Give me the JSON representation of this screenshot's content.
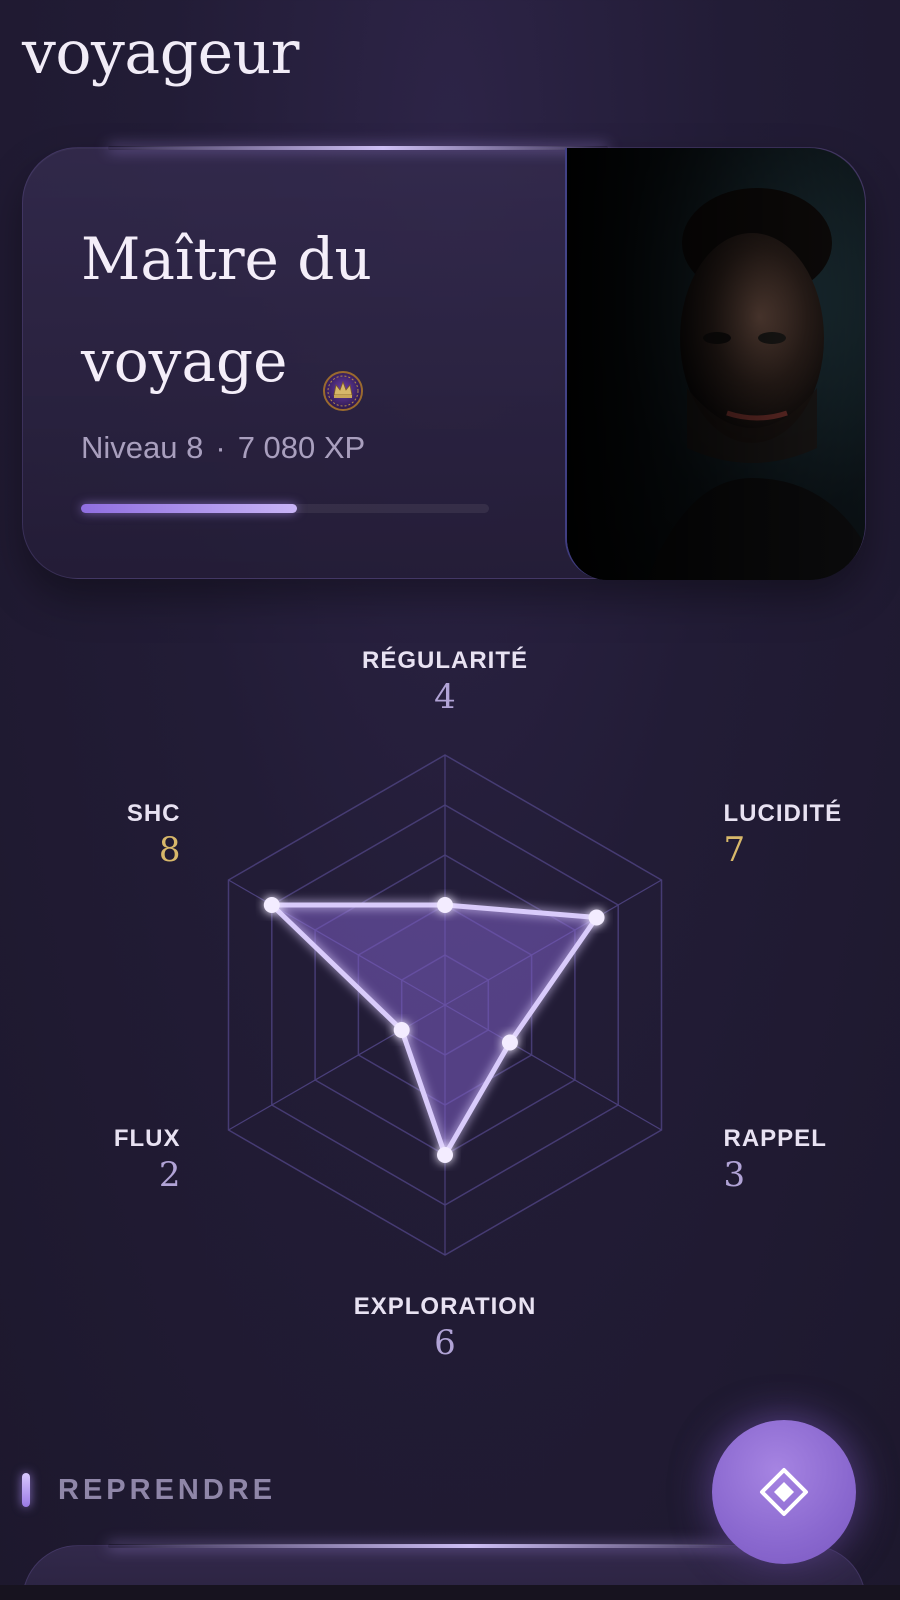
{
  "header": {
    "title": "voyageur"
  },
  "profile": {
    "rank_line1": "Maître du",
    "rank_line2": "voyage",
    "rank_icon": "crown-medallion-icon",
    "level_label": "Niveau 8",
    "separator": "·",
    "xp_label": "7 080 XP",
    "xp_progress": 0.53,
    "portrait_icon": "user-portrait"
  },
  "radar": {
    "max": 10,
    "axes": [
      {
        "key": "regularite",
        "label": "RÉGULARITÉ",
        "value": 4,
        "value_text": "4",
        "highlight": false
      },
      {
        "key": "lucidite",
        "label": "LUCIDITÉ",
        "value": 7,
        "value_text": "7",
        "highlight": true
      },
      {
        "key": "rappel",
        "label": "RAPPEL",
        "value": 3,
        "value_text": "3",
        "highlight": false
      },
      {
        "key": "exploration",
        "label": "EXPLORATION",
        "value": 6,
        "value_text": "6",
        "highlight": false
      },
      {
        "key": "flux",
        "label": "FLUX",
        "value": 2,
        "value_text": "2",
        "highlight": false
      },
      {
        "key": "shc",
        "label": "SHC",
        "value": 8,
        "value_text": "8",
        "highlight": true
      }
    ],
    "colors": {
      "fill": "#7d5fc4",
      "stroke": "#d9cbfb",
      "grid": "#4a3f7a",
      "highlight_value": "#d8b86a",
      "muted_value": "#b1a3d6"
    }
  },
  "resume": {
    "label": "REPRENDRE"
  },
  "fab": {
    "icon": "diamond-icon"
  }
}
